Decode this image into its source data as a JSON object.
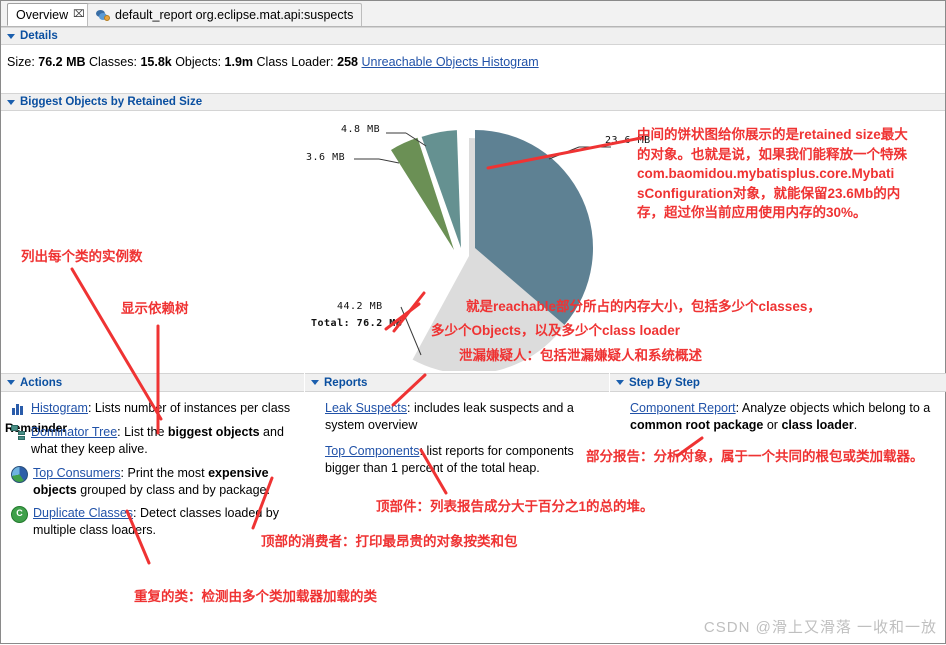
{
  "tabs": [
    {
      "label": "Overview",
      "close": "⌧",
      "active": true,
      "icon": "none"
    },
    {
      "label": "default_report  org.eclipse.mat.api:suspects",
      "active": false,
      "icon": "report-icon"
    }
  ],
  "details": {
    "header": "Details",
    "size_label": "Size:",
    "size_value": "76.2 MB",
    "classes_label": "Classes:",
    "classes_value": "15.8k",
    "objects_label": "Objects:",
    "objects_value": "1.9m",
    "classloader_label": "Class Loader:",
    "classloader_value": "258",
    "link": "Unreachable Objects Histogram"
  },
  "biggest": {
    "header": "Biggest Objects by Retained Size",
    "remainder_label": "Remainder"
  },
  "chart_data": {
    "type": "pie",
    "title": "Biggest Objects by Retained Size",
    "total_label": "Total: 76.2 MB",
    "unit": "MB",
    "categories": [
      "23.6 MB",
      "4.8 MB",
      "3.6 MB",
      "44.2 MB"
    ],
    "values": [
      23.6,
      4.8,
      3.6,
      44.2
    ],
    "labels": [
      "23.6 MB",
      "4.8 MB",
      "3.6 MB",
      "44.2 MB"
    ],
    "colors": [
      "#5e8193",
      "#659191",
      "#6b9055",
      "#dcdcdc"
    ],
    "exploded": [
      true,
      true,
      true,
      false
    ],
    "legend": "none",
    "grid": false
  },
  "panels": {
    "actions": {
      "header": "Actions",
      "items": [
        {
          "icon": "histogram-icon",
          "link": "Histogram",
          "rest": ": Lists number of instances per class"
        },
        {
          "icon": "dominator-tree-icon",
          "link": "Dominator Tree",
          "rest_a": ": List the ",
          "bold": "biggest objects",
          "rest_b": " and what they keep alive."
        },
        {
          "icon": "top-consumers-icon",
          "link": "Top Consumers",
          "rest_a": ": Print the most ",
          "bold": "expensive objects",
          "rest_b": " grouped by class and by package."
        },
        {
          "icon": "duplicate-classes-icon",
          "link": "Duplicate Classes",
          "rest": ": Detect classes loaded by multiple class loaders."
        }
      ]
    },
    "reports": {
      "header": "Reports",
      "items": [
        {
          "link": "Leak Suspects",
          "rest": ": includes leak suspects and a system overview"
        },
        {
          "link": "Top Components",
          "rest": ": list reports for components bigger than 1 percent of the total heap."
        }
      ]
    },
    "step_by_step": {
      "header": "Step By Step",
      "items": [
        {
          "link": "Component Report",
          "rest_a": ": Analyze objects which belong to a ",
          "bold_a": "common root package",
          "mid": " or ",
          "bold_b": "class loader",
          "rest_b": "."
        }
      ]
    }
  },
  "annotations": {
    "pie_note_lines": [
      "中间的饼状图给你展示的是retained size最大",
      "的对象。也就是说，如果我们能释放一个特殊",
      "com.baomidou.mybatisplus.core.Mybati",
      "sConfiguration对象，就能保留23.6Mb的内",
      "存，超过你当前应用使用内存的30%。"
    ],
    "histogram_note": "列出每个类的实例数",
    "dominator_note": "显示依赖树",
    "total_note_line1": "就是reachable部分所占的内存大小，包括多少个classes，",
    "total_note_line2": "多少个Objects，以及多少个class loader",
    "leak_note": "泄漏嫌疑人：包括泄漏嫌疑人和系统概述",
    "component_note": "部分报告：分析对象，属于一个共同的根包或类加载器。",
    "top_components_note": "顶部件：列表报告成分大于百分之1的总的堆。",
    "top_consumers_note": "顶部的消费者：打印最昂贵的对象按类和包",
    "duplicate_note": "重复的类：检测由多个类加载器加载的类"
  },
  "watermark": "CSDN @滑上又滑落 一收和一放",
  "theme": {
    "link_color": "#2152a8",
    "header_color": "#0a4fa0",
    "annotation_color": "#ef3333"
  }
}
